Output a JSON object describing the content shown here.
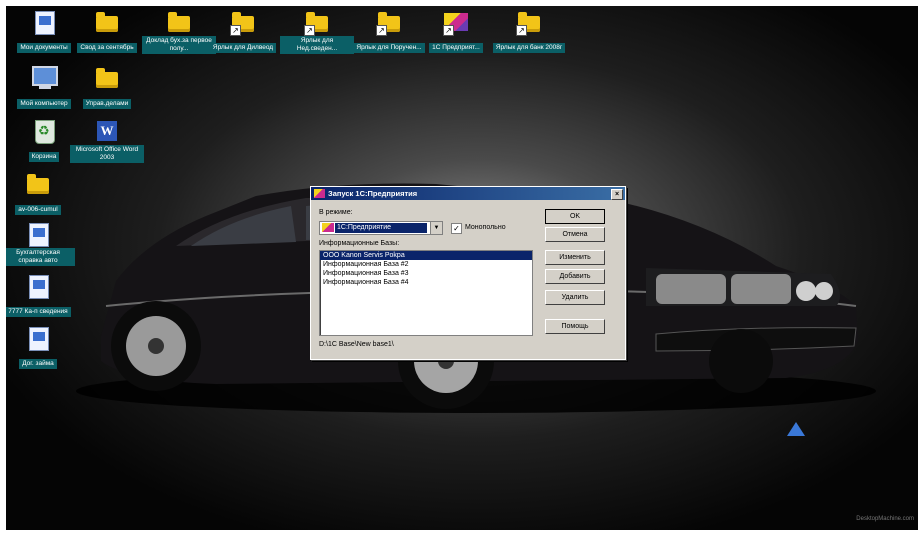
{
  "desktop_icons": [
    {
      "label": "Мои документы"
    },
    {
      "label": "Свод за сентябрь"
    },
    {
      "label": "Доклад бух.за первое полу..."
    },
    {
      "label": "Ярлык для Дилвеод"
    },
    {
      "label": "Ярлык для Нед.сведен..."
    },
    {
      "label": "Ярлык для Поручен..."
    },
    {
      "label": "1С Предприят..."
    },
    {
      "label": "Ярлык для банк 2008г"
    },
    {
      "label": "Мой компьютер"
    },
    {
      "label": "Управ.делами"
    },
    {
      "label": "Корзина"
    },
    {
      "label": "Microsoft Office Word 2003"
    },
    {
      "label": "av-006-cumul"
    },
    {
      "label": "Бухгалтерская справка авто"
    },
    {
      "label": "7777 Ка-п сведения"
    },
    {
      "label": "Дог. займа"
    }
  ],
  "dialog": {
    "title": "Запуск 1С:Предприятия",
    "close": "×",
    "mode_label": "В режиме:",
    "mode_value": "1С:Предприятие",
    "exclusive_label": "Монопольно",
    "exclusive_checked": true,
    "bases_label": "Информационные Базы:",
    "bases": [
      "ООО Kanon Servis Pokpa",
      "Информационная База #2",
      "Информационная База #3",
      "Информационная База #4"
    ],
    "selected_index": 0,
    "path": "D:\\1C Base\\New base1\\",
    "buttons": {
      "ok": "OK",
      "cancel": "Отмена",
      "edit": "Изменить",
      "add": "Добавить",
      "delete": "Удалить",
      "help": "Помощь"
    }
  },
  "watermark": "DesktopMachine.com"
}
